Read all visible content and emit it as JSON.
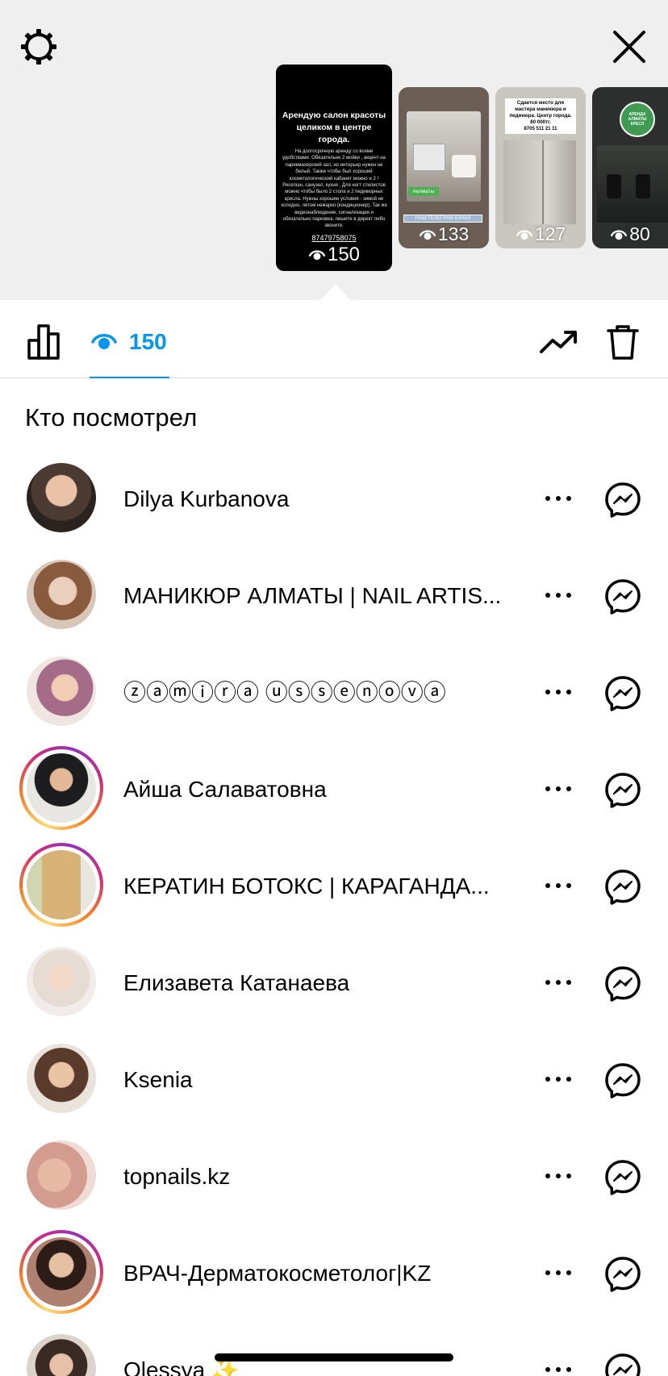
{
  "top_bar": {
    "settings_icon": "gear-icon",
    "close_icon": "close-icon"
  },
  "stories": [
    {
      "id": "main",
      "selected": true,
      "title": "Арендую салон красоты целиком в центре города.",
      "body": "На долгосрочную аренду со всеми удобствами. Обязательно 2 мойки , акцент на парикмахерский зал, но интерьер нужен не белый. Также чтобы был хороший косметологический кабинет можно и 2 ! Ресепшн, санузел, кухня . Для ногт стилистов можно чтобы было 2 стола и 2 педикюрных кресла. Нужны хорошие условия - зимой не холодно, летом нежарко (кондиционер). Так же видеонаблюдение, сигнализация и обязательно парковка. пишите в директ либо звоните:",
      "phone": "87479758075",
      "views": "150"
    },
    {
      "id": "s2",
      "tag_green": "#алматы",
      "tag_blue": "НАШ ТЕЛЕГРАМ КАНАЛ",
      "views": "133"
    },
    {
      "id": "s3",
      "note": "Сдается место для мастера маникюра и педикюра. Центр города. 80 000тг.",
      "phone": "8705 511 21 11",
      "views": "127"
    },
    {
      "id": "s4",
      "badge": "АРЕНДА АЛМАТЫ КРЕСЛ",
      "views": "80"
    }
  ],
  "tabs": {
    "stats_icon": "bar-chart-icon",
    "views_icon": "eye-icon",
    "views_count": "150",
    "trend_icon": "trending-up-icon",
    "delete_icon": "trash-icon"
  },
  "section_title": "Кто посмотрел",
  "viewers": [
    {
      "name": "Dilya Kurbanova",
      "story_ring": false
    },
    {
      "name": "МАНИКЮР АЛМАТЫ | NAIL ARTIS...",
      "story_ring": false
    },
    {
      "name": "ⓩⓐⓜⓘⓡⓐ ⓤⓢⓢⓔⓝⓞⓥⓐ",
      "story_ring": false
    },
    {
      "name": "Айша Салаватовна",
      "story_ring": true
    },
    {
      "name": "КЕРАТИН БОТОКС | КАРАГАНДА...",
      "story_ring": true
    },
    {
      "name": "Елизавета Катанаева",
      "story_ring": false
    },
    {
      "name": "Ksenia",
      "story_ring": false
    },
    {
      "name": "topnails.kz",
      "story_ring": false
    },
    {
      "name": "ВРАЧ-Дерматокосметолог|KZ",
      "story_ring": true
    },
    {
      "name": "Olessya ✨",
      "story_ring": false
    }
  ],
  "colors": {
    "accent": "#0095f6",
    "top_background": "#efefef",
    "divider": "#dbdbdb",
    "ring_start": "#feda75",
    "ring_end": "#d62976"
  }
}
